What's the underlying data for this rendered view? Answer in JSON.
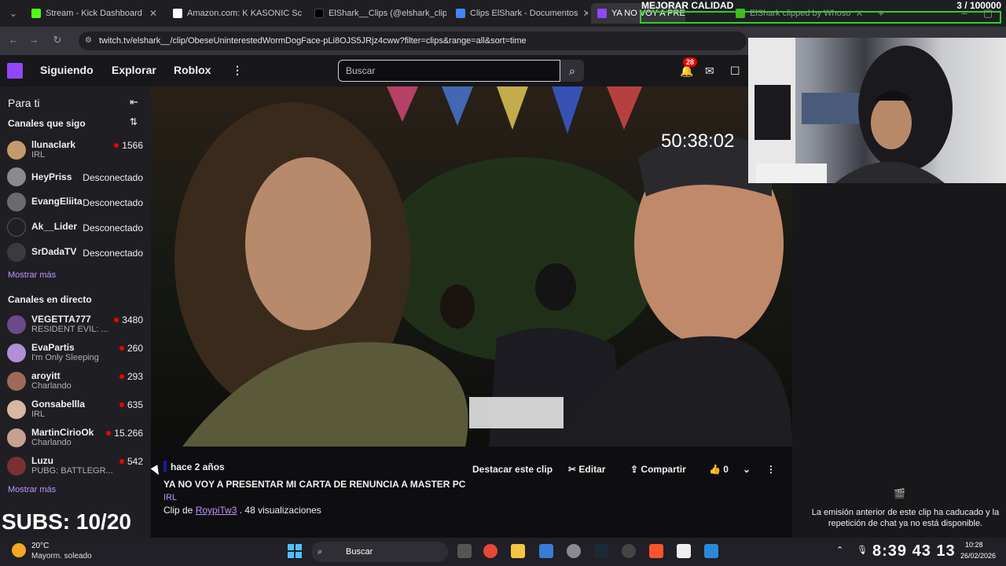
{
  "browser": {
    "tabs": [
      {
        "label": "Stream - Kick Dashboard",
        "color": "#53fc18"
      },
      {
        "label": "Amazon.com: K KASONIC Sc",
        "color": "#ffffff"
      },
      {
        "label": "ElShark__Clips (@elshark_clip",
        "color": "#000000"
      },
      {
        "label": "Clips ElShark - Documentos",
        "color": "#4285f4"
      },
      {
        "label": "YA NO VOY A PRESENT",
        "color": "#9147ff"
      },
      {
        "label": "ElShark clipped by Whoso",
        "color": "#53fc18"
      }
    ],
    "url": "twitch.tv/elshark__/clip/ObeseUninterestedWormDogFace-pLi8OJS5JRjz4cww?filter=clips&range=all&sort=time"
  },
  "stream_overlay": {
    "quality_label": "MEJORAR CALIDAD",
    "goal_count": "3 / 100000",
    "stream_timer": "50:38:02",
    "subs_label": "SUBS: 10/20",
    "big_clock": "8:39 43 13"
  },
  "nav": {
    "following": "Siguiendo",
    "explore": "Explorar",
    "game": "Roblox",
    "search_placeholder": "Buscar",
    "notif_count": "28"
  },
  "sidebar": {
    "for_you": "Para ti",
    "followed_header": "Canales que sigo",
    "followed": [
      {
        "name": "llunaclark",
        "category": "IRL",
        "viewers": "1566",
        "status": "",
        "avatar_color": "#c49a6c"
      },
      {
        "name": "HeyPriss",
        "category": "",
        "viewers": "",
        "status": "Desconectado",
        "avatar_color": "#8a8a90"
      },
      {
        "name": "EvangEliita",
        "category": "",
        "viewers": "",
        "status": "Desconectado",
        "avatar_color": "#6a6a70"
      },
      {
        "name": "Ak__Lider",
        "category": "",
        "viewers": "",
        "status": "Desconectado",
        "avatar_color": "#202024"
      },
      {
        "name": "SrDadaTV",
        "category": "",
        "viewers": "",
        "status": "Desconectado",
        "avatar_color": "#3a3a40"
      }
    ],
    "show_more_1": "Mostrar más",
    "live_header": "Canales en directo",
    "live": [
      {
        "name": "VEGETTA777",
        "category": "RESIDENT EVIL: ...",
        "viewers": "3480",
        "avatar_color": "#6a4a8a"
      },
      {
        "name": "EvaPartis",
        "category": "I'm Only Sleeping",
        "viewers": "260",
        "avatar_color": "#b08fd8"
      },
      {
        "name": "aroyitt",
        "category": "Charlando",
        "viewers": "293",
        "avatar_color": "#a06a5a"
      },
      {
        "name": "Gonsabellla",
        "category": "IRL",
        "viewers": "635",
        "avatar_color": "#d8b8a0"
      },
      {
        "name": "MartinCirioOk",
        "category": "Charlando",
        "viewers": "15.266",
        "avatar_color": "#c8a090"
      },
      {
        "name": "Luzu",
        "category": "PUBG: BATTLEGR...",
        "viewers": "542",
        "avatar_color": "#7a3030"
      }
    ],
    "show_more_2": "Mostrar más"
  },
  "clip": {
    "time_ago": "hace 2 años",
    "title": "YA NO VOY A PRESENTAR MI CARTA DE RENUNCIA A MASTER PC",
    "category": "IRL",
    "clip_by_prefix": "Clip de",
    "clipper": "RoypiTw3",
    "views": ". 48 visualizaciones",
    "feature_button": "Destacar este clip",
    "edit_button": "Editar",
    "share_button": "Compartir",
    "like_count": "0"
  },
  "chat": {
    "message": "La emisión anterior de este clip ha caducado y la repetición de chat ya no está disponible."
  },
  "taskbar": {
    "temp": "20°C",
    "weather": "Mayorm. soleado",
    "search": "Buscar",
    "time": "10:28",
    "date": "26/02/2026"
  }
}
